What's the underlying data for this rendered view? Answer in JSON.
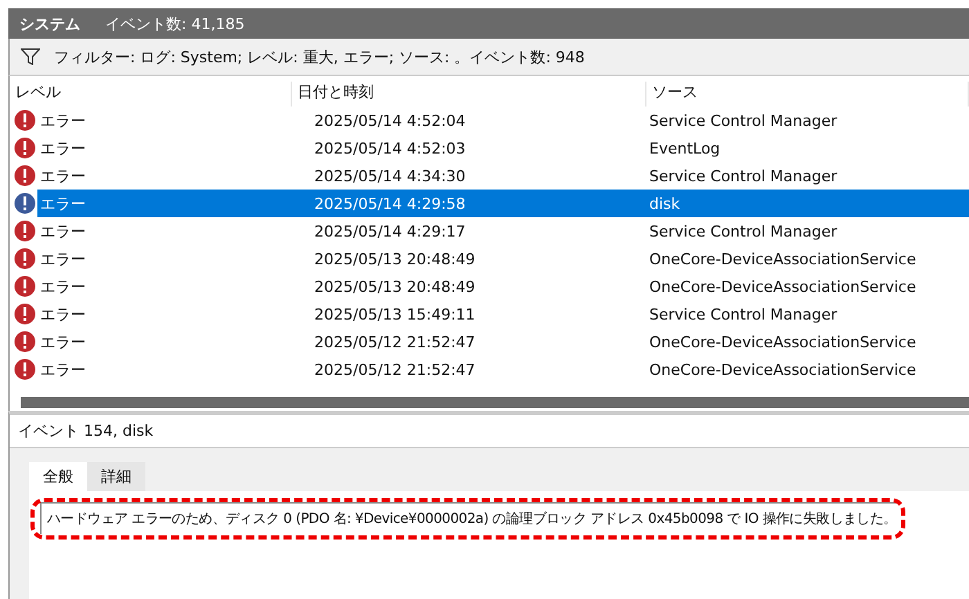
{
  "header": {
    "title": "システム",
    "count": "イベント数: 41,185"
  },
  "filter": {
    "text": "フィルター: ログ: System; レベル: 重大, エラー; ソース: 。イベント数: 948"
  },
  "table": {
    "columns": [
      "レベル",
      "日付と時刻",
      "ソース"
    ],
    "rows": [
      {
        "level": "エラー",
        "datetime": "2025/05/14 4:52:04",
        "source": "Service Control Manager",
        "selected": false
      },
      {
        "level": "エラー",
        "datetime": "2025/05/14 4:52:03",
        "source": "EventLog",
        "selected": false
      },
      {
        "level": "エラー",
        "datetime": "2025/05/14 4:34:30",
        "source": "Service Control Manager",
        "selected": false
      },
      {
        "level": "エラー",
        "datetime": "2025/05/14 4:29:58",
        "source": "disk",
        "selected": true
      },
      {
        "level": "エラー",
        "datetime": "2025/05/14 4:29:17",
        "source": "Service Control Manager",
        "selected": false
      },
      {
        "level": "エラー",
        "datetime": "2025/05/13 20:48:49",
        "source": "OneCore-DeviceAssociationService",
        "selected": false
      },
      {
        "level": "エラー",
        "datetime": "2025/05/13 20:48:49",
        "source": "OneCore-DeviceAssociationService",
        "selected": false
      },
      {
        "level": "エラー",
        "datetime": "2025/05/13 15:49:11",
        "source": "Service Control Manager",
        "selected": false
      },
      {
        "level": "エラー",
        "datetime": "2025/05/12 21:52:47",
        "source": "OneCore-DeviceAssociationService",
        "selected": false
      },
      {
        "level": "エラー",
        "datetime": "2025/05/12 21:52:47",
        "source": "OneCore-DeviceAssociationService",
        "selected": false
      }
    ]
  },
  "detail": {
    "title": "イベント 154, disk",
    "tabs": [
      {
        "label": "全般",
        "selected": true
      },
      {
        "label": "詳細",
        "selected": false
      }
    ],
    "message": "ハードウェア エラーのため、ディスク 0 (PDO 名: ¥Device¥0000002a) の論理ブロック アドレス 0x45b0098 で IO 操作に失敗しました。"
  }
}
